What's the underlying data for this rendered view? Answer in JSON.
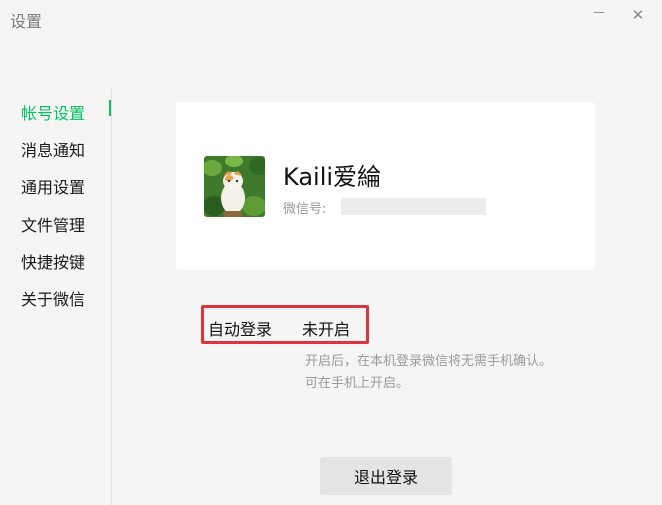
{
  "window": {
    "title": "设置",
    "minimize_icon": "minimize-icon",
    "close_icon": "close-icon",
    "close_glyph": "✕"
  },
  "sidebar": {
    "items": [
      {
        "label": "帐号设置",
        "active": true
      },
      {
        "label": "消息通知",
        "active": false
      },
      {
        "label": "通用设置",
        "active": false
      },
      {
        "label": "文件管理",
        "active": false
      },
      {
        "label": "快捷按键",
        "active": false
      },
      {
        "label": "关于微信",
        "active": false
      }
    ],
    "active_color": "#07c160"
  },
  "profile": {
    "nickname": "Kaili爱綸",
    "wechat_id_label": "微信号:",
    "avatar_icon": "cat-avatar-icon"
  },
  "auto_login": {
    "label": "自动登录",
    "value": "未开启",
    "hint_line1": "开启后，在本机登录微信将无需手机确认。",
    "hint_line2": "可在手机上开启。",
    "highlight_color": "#e0343c"
  },
  "logout_button": "退出登录"
}
